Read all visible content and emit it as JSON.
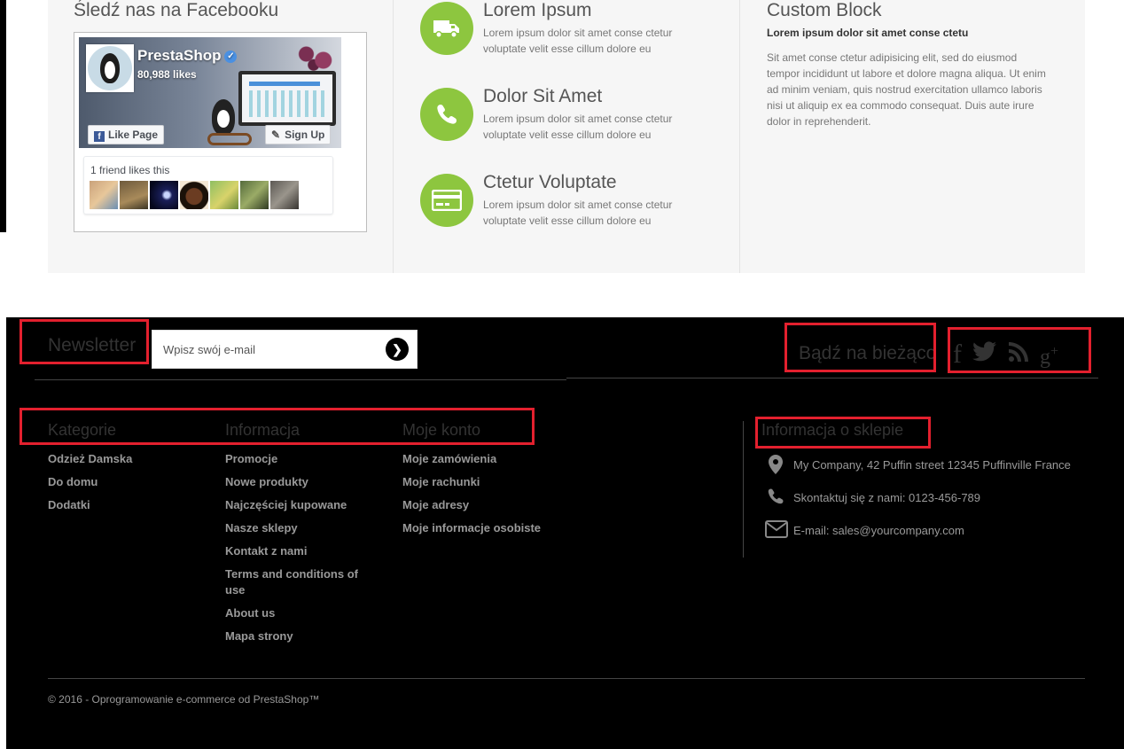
{
  "facebook": {
    "title": "Śledź nas na Facebooku",
    "page_name": "PrestaShop",
    "likes": "80,988 likes",
    "like_button": "Like Page",
    "signup_button": "Sign Up",
    "friends_text": "1 friend likes this"
  },
  "info_blocks": [
    {
      "title": "Lorem Ipsum",
      "icon": "truck-icon",
      "text": "Lorem ipsum dolor sit amet conse ctetur voluptate velit esse cillum dolore eu"
    },
    {
      "title": "Dolor Sit Amet",
      "icon": "phone-icon",
      "text": "Lorem ipsum dolor sit amet conse ctetur voluptate velit esse cillum dolore eu"
    },
    {
      "title": "Ctetur Voluptate",
      "icon": "credit-card-icon",
      "text": "Lorem ipsum dolor sit amet conse ctetur voluptate velit esse cillum dolore eu"
    }
  ],
  "custom_block": {
    "title": "Custom Block",
    "subtitle": "Lorem ipsum dolor sit amet conse ctetu",
    "text": "Sit amet conse ctetur adipisicing elit, sed do eiusmod tempor incididunt ut labore et dolore magna aliqua. Ut enim ad minim veniam, quis nostrud exercitation ullamco laboris nisi ut aliquip ex ea commodo consequat. Duis aute irure dolor in reprehenderit."
  },
  "newsletter": {
    "title": "Newsletter",
    "placeholder": "Wpisz swój e-mail",
    "submit_icon": "chevron-right-icon"
  },
  "follow": {
    "title": "Bądź na bieżąco",
    "icons": [
      "facebook-icon",
      "twitter-icon",
      "rss-icon",
      "google-plus-icon"
    ]
  },
  "categories": {
    "title": "Kategorie",
    "items": [
      "Odzież Damska",
      "Do domu",
      "Dodatki"
    ]
  },
  "information": {
    "title": "Informacja",
    "items": [
      "Promocje",
      "Nowe produkty",
      "Najczęściej kupowane",
      "Nasze sklepy",
      "Kontakt z nami",
      "Terms and conditions of use",
      "About us",
      "Mapa strony"
    ]
  },
  "account": {
    "title": "Moje konto",
    "items": [
      "Moje zamówienia",
      "Moje rachunki",
      "Moje adresy",
      "Moje informacje osobiste"
    ]
  },
  "store_info": {
    "title": "Informacja o sklepie",
    "address": "My Company, 42 Puffin street 12345 Puffinville France",
    "phone": "Skontaktuj się z nami: 0123-456-789",
    "email": "E-mail: sales@yourcompany.com"
  },
  "copyright": "© 2016 - Oprogramowanie e-commerce od PrestaShop™",
  "colors": {
    "accent_green": "#8dc63f",
    "footer_bg": "#000000",
    "annotation_red": "#e3202e",
    "block_bg": "#f6f6f6"
  }
}
